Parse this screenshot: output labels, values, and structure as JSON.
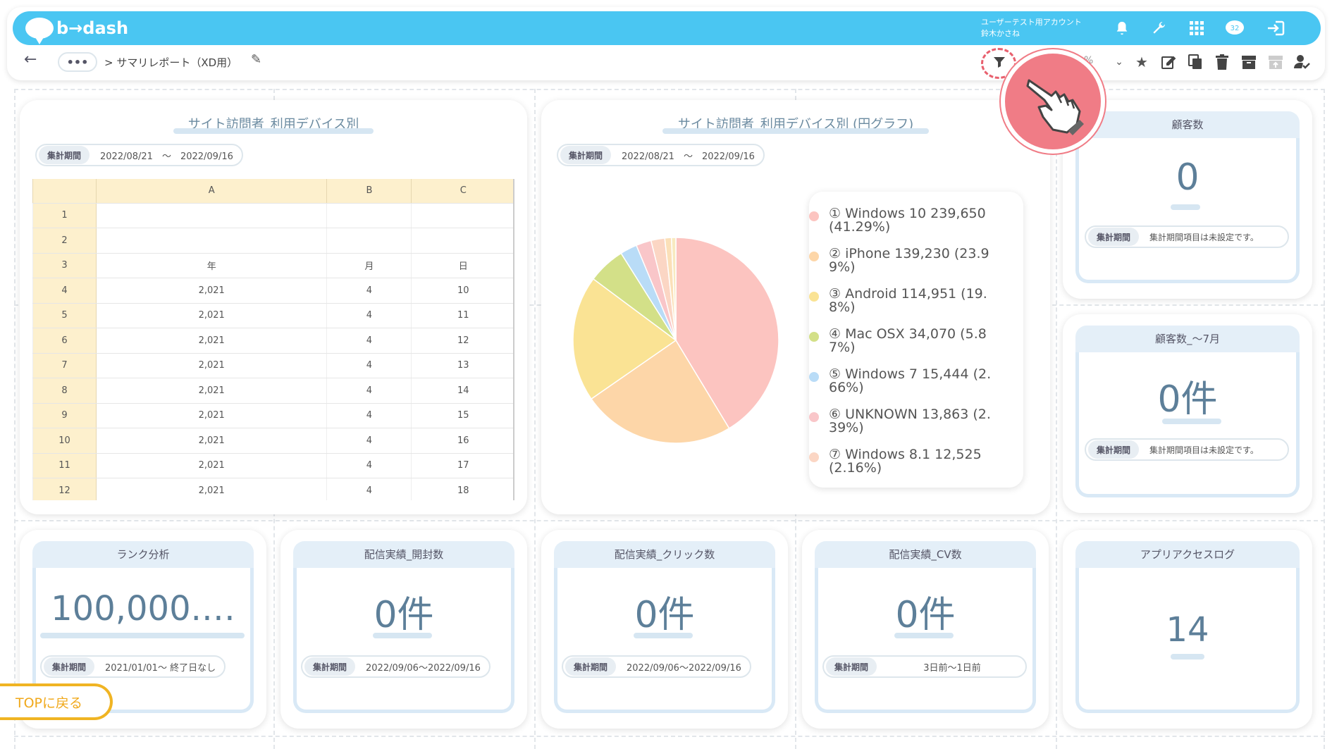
{
  "header": {
    "logo_text": "b→dash",
    "account_line1": "ユーザーテスト用アカウント",
    "account_line2": "鈴木かさね",
    "badge": "32"
  },
  "toolbar": {
    "breadcrumb": "> サマリレポート（XD用）",
    "dots": "•••",
    "partial_text": "%"
  },
  "cards": {
    "table_card": {
      "title": "サイト訪問者_利用デバイス別",
      "period_label": "集計期間",
      "period_value": "2022/08/21　～　2022/09/16"
    },
    "pie_card": {
      "title": "サイト訪問者_利用デバイス別 (円グラフ)",
      "period_label": "集計期間",
      "period_value": "2022/08/21　～　2022/09/16"
    },
    "customers": {
      "title": "顧客数",
      "value": "0",
      "period_label": "集計期間",
      "period_value": "集計期間項目は未設定です。"
    },
    "customers_july": {
      "title": "顧客数_～7月",
      "value": "0件",
      "period_label": "集計期間",
      "period_value": "集計期間項目は未設定です。"
    },
    "rank": {
      "title": "ランク分析",
      "value": "100,000.…",
      "period_label": "集計期間",
      "period_value": "2021/01/01～ 終了日なし"
    },
    "opens": {
      "title": "配信実績_開封数",
      "value": "0件",
      "period_label": "集計期間",
      "period_value": "2022/09/06～2022/09/16"
    },
    "clicks": {
      "title": "配信実績_クリック数",
      "value": "0件",
      "period_label": "集計期間",
      "period_value": "2022/09/06～2022/09/16"
    },
    "cv": {
      "title": "配信実績_CV数",
      "value": "0件",
      "period_label": "集計期間",
      "period_value": "3日前～1日前"
    },
    "app_log": {
      "title": "アプリアクセスログ",
      "value": "14"
    }
  },
  "sheet": {
    "columns": [
      "A",
      "B",
      "C"
    ],
    "rows": [
      [
        "1",
        "",
        "",
        ""
      ],
      [
        "2",
        "",
        "",
        ""
      ],
      [
        "3",
        "年",
        "月",
        "日"
      ],
      [
        "4",
        "2,021",
        "4",
        "10"
      ],
      [
        "5",
        "2,021",
        "4",
        "11"
      ],
      [
        "6",
        "2,021",
        "4",
        "12"
      ],
      [
        "7",
        "2,021",
        "4",
        "13"
      ],
      [
        "8",
        "2,021",
        "4",
        "14"
      ],
      [
        "9",
        "2,021",
        "4",
        "15"
      ],
      [
        "10",
        "2,021",
        "4",
        "16"
      ],
      [
        "11",
        "2,021",
        "4",
        "17"
      ],
      [
        "12",
        "2,021",
        "4",
        "18"
      ]
    ]
  },
  "chart_data": {
    "type": "pie",
    "labels": [
      "① Windows 10 239,650 (41.29%)",
      "② iPhone 139,230 (23.99%)",
      "③ Android 114,951 (19.8%)",
      "④ Mac OSX 34,070 (5.87%)",
      "⑤ Windows 7 15,444 (2.66%)",
      "⑥ UNKNOWN 13,863 (2.39%)",
      "⑦ Windows 8.1 12,525 (2.16%)"
    ],
    "legend_text": [
      "① Windows 10 239,650 (41.29%)",
      "② iPhone 139,230 (23.9 9%)",
      "③ Android 114,951 (19. 8%)",
      "④ Mac OSX 34,070 (5.8 7%)",
      "⑤ Windows 7 15,444 (2. 66%)",
      "⑥ UNKNOWN 13,863 (2. 39%)",
      "⑦ Windows 8.1 12,525 (2.16%)"
    ],
    "values": [
      239650,
      139230,
      114951,
      34070,
      15444,
      13863,
      12525,
      6000,
      4000
    ],
    "colors": [
      "#fcc4c0",
      "#fdd6a8",
      "#fae394",
      "#d3e088",
      "#b9dcf7",
      "#f9c6c9",
      "#fbd6c4",
      "#fbe0b8",
      "#f8eac0"
    ],
    "legend_placement": "right"
  },
  "footer": {
    "top_button": "TOPに戻る"
  }
}
